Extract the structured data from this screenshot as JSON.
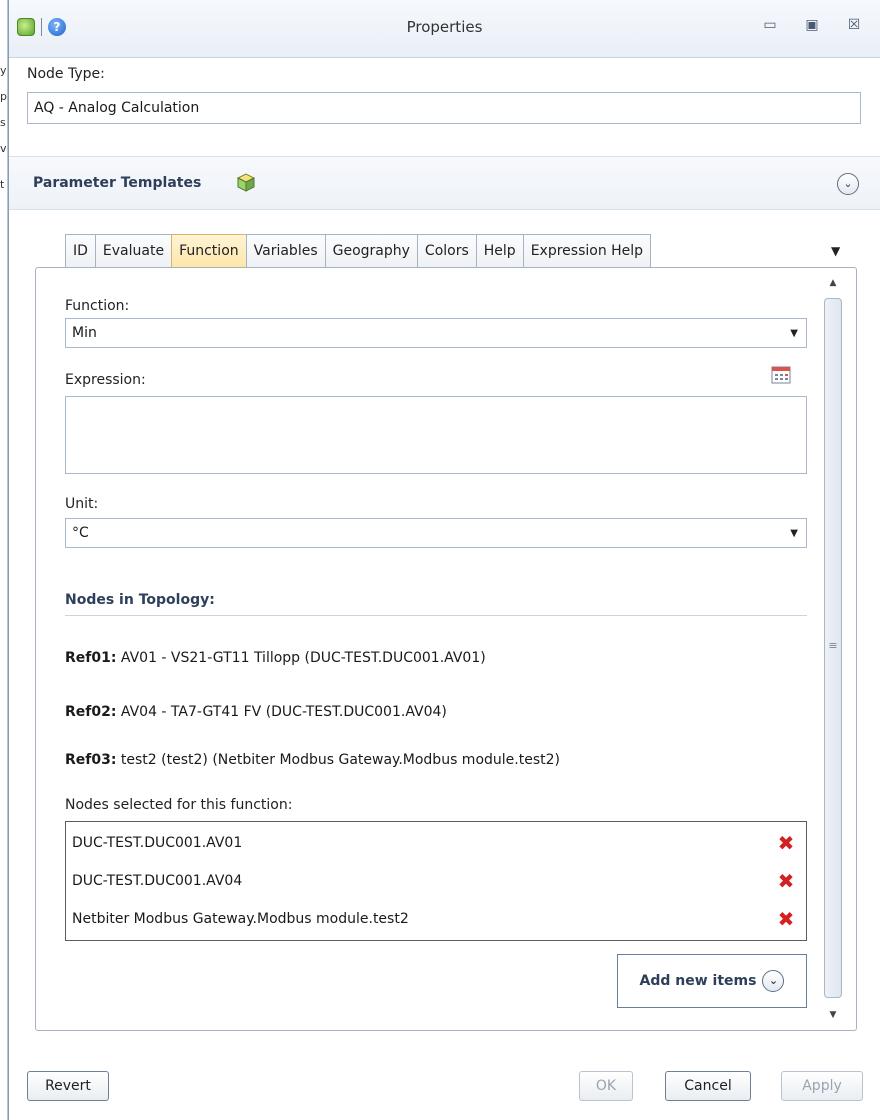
{
  "window": {
    "title": "Properties",
    "controls": {
      "minimize": "▭",
      "restore": "▣",
      "close": "☒"
    }
  },
  "left_strip_chars": [
    "y",
    "p",
    "s",
    "v",
    "t"
  ],
  "node_type": {
    "label": "Node Type:",
    "value": "AQ - Analog Calculation"
  },
  "parameter_templates": {
    "title": "Parameter Templates"
  },
  "tabs": [
    {
      "label": "ID",
      "active": false
    },
    {
      "label": "Evaluate",
      "active": false
    },
    {
      "label": "Function",
      "active": true
    },
    {
      "label": "Variables",
      "active": false
    },
    {
      "label": "Geography",
      "active": false
    },
    {
      "label": "Colors",
      "active": false
    },
    {
      "label": "Help",
      "active": false
    },
    {
      "label": "Expression Help",
      "active": false
    }
  ],
  "function_tab": {
    "function_label": "Function:",
    "function_value": "Min",
    "expression_label": "Expression:",
    "expression_value": "",
    "unit_label": "Unit:",
    "unit_value": "°C",
    "nodes_heading": "Nodes in Topology:",
    "refs": [
      {
        "key": "Ref01:",
        "text": "AV01 - VS21-GT11 Tillopp (DUC-TEST.DUC001.AV01)"
      },
      {
        "key": "Ref02:",
        "text": "AV04 - TA7-GT41 FV (DUC-TEST.DUC001.AV04)"
      },
      {
        "key": "Ref03:",
        "text": "test2 (test2) (Netbiter Modbus Gateway.Modbus module.test2)"
      }
    ],
    "selected_label": "Nodes selected for this function:",
    "selected_nodes": [
      "DUC-TEST.DUC001.AV01",
      "DUC-TEST.DUC001.AV04",
      "Netbiter Modbus Gateway.Modbus module.test2"
    ],
    "add_new_items": "Add new items"
  },
  "footer": {
    "revert": "Revert",
    "ok": "OK",
    "cancel": "Cancel",
    "apply": "Apply"
  },
  "icons": {
    "dropdown": "▼",
    "chevron": "⌄",
    "delete": "✖",
    "scroll_up": "▲",
    "scroll_down": "▼",
    "scroll_grip": "≡"
  }
}
